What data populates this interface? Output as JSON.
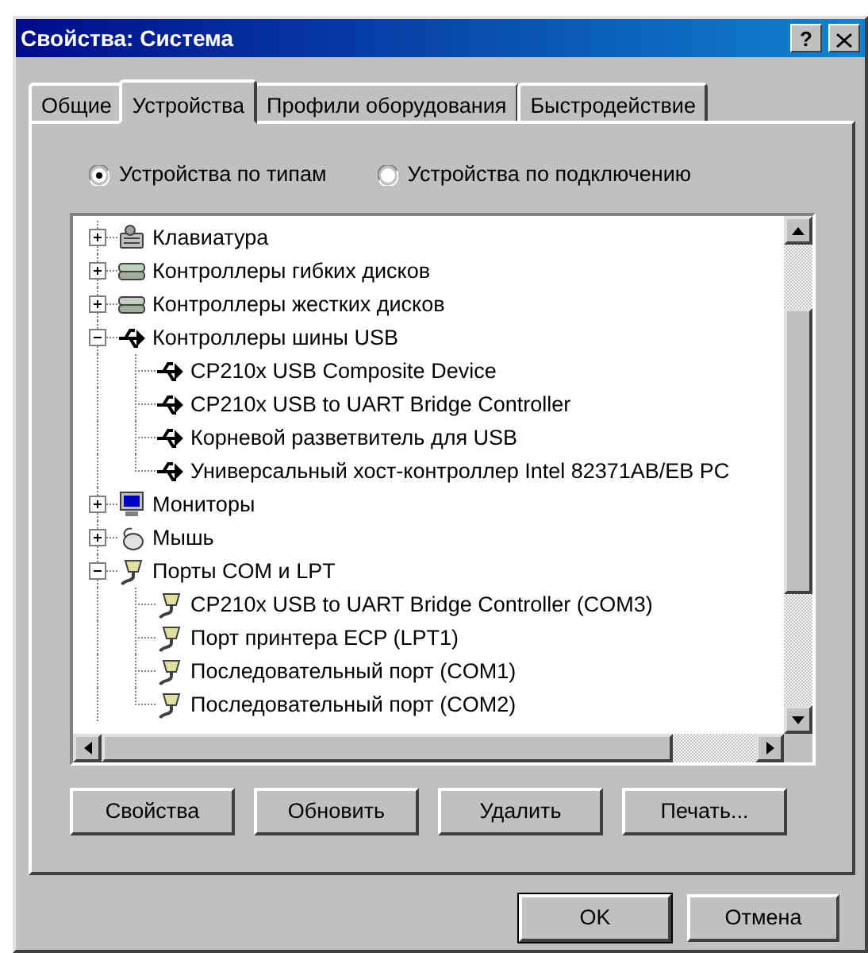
{
  "window": {
    "title": "Свойства: Система",
    "help_button": "?"
  },
  "tabs": [
    {
      "label": "Общие",
      "selected": false
    },
    {
      "label": "Устройства",
      "selected": true
    },
    {
      "label": "Профили оборудования",
      "selected": false
    },
    {
      "label": "Быстродействие",
      "selected": false
    }
  ],
  "view_options": [
    {
      "label": "Устройства по типам",
      "selected": true
    },
    {
      "label": "Устройства по подключению",
      "selected": false
    }
  ],
  "device_tree": [
    {
      "label": "Клавиатура",
      "kind": "keyboard",
      "expanded": false
    },
    {
      "label": "Контроллеры гибких дисков",
      "kind": "drive",
      "expanded": false
    },
    {
      "label": "Контроллеры жестких дисков",
      "kind": "drive",
      "expanded": false
    },
    {
      "label": "Контроллеры шины USB",
      "kind": "usb",
      "expanded": true,
      "children": [
        {
          "label": "CP210x USB Composite Device",
          "kind": "usb"
        },
        {
          "label": "CP210x USB to UART Bridge Controller",
          "kind": "usb"
        },
        {
          "label": "Корневой разветвитель для USB",
          "kind": "usb"
        },
        {
          "label": "Универсальный хост-контроллер Intel 82371AB/EB PC",
          "kind": "usb"
        }
      ]
    },
    {
      "label": "Мониторы",
      "kind": "monitor",
      "expanded": false
    },
    {
      "label": "Мышь",
      "kind": "mouse",
      "expanded": false
    },
    {
      "label": "Порты COM и LPT",
      "kind": "port",
      "expanded": true,
      "children": [
        {
          "label": "CP210x USB to UART Bridge Controller (COM3)",
          "kind": "port"
        },
        {
          "label": "Порт принтера ECP (LPT1)",
          "kind": "port"
        },
        {
          "label": "Последовательный порт (COM1)",
          "kind": "port"
        },
        {
          "label": "Последовательный порт (COM2)",
          "kind": "port"
        }
      ]
    }
  ],
  "device_buttons": [
    "Свойства",
    "Обновить",
    "Удалить",
    "Печать..."
  ],
  "dialog_buttons": [
    {
      "label": "OK",
      "default": true
    },
    {
      "label": "Отмена",
      "default": false
    }
  ]
}
